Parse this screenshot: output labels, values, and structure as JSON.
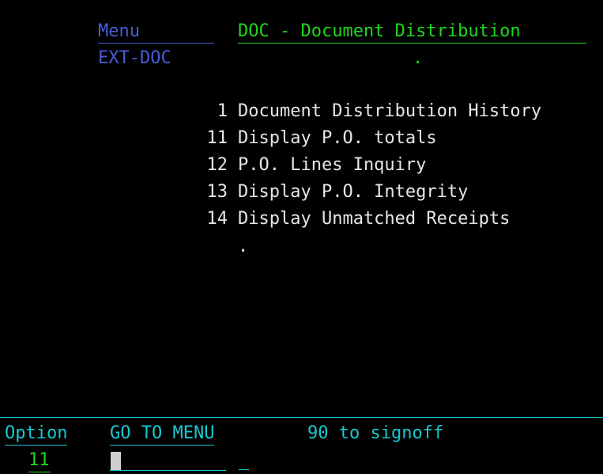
{
  "header": {
    "menu_label": "Menu",
    "menu_title": "DOC - Document Distribution",
    "menu_id": "EXT-DOC",
    "dot": "."
  },
  "options": [
    {
      "num": "1",
      "label": "Document Distribution History"
    },
    {
      "num": "11",
      "label": "Display P.O. totals"
    },
    {
      "num": "12",
      "label": "P.O. Lines Inquiry"
    },
    {
      "num": "13",
      "label": "Display P.O. Integrity"
    },
    {
      "num": "14",
      "label": "Display Unmatched Receipts"
    }
  ],
  "list_end_dot": ".",
  "footer": {
    "option_label": "Option",
    "goto_label": "GO TO MENU",
    "signoff_label": "90 to signoff",
    "option_value": "11",
    "command_value": ""
  },
  "colors": {
    "background": "#000000",
    "blue": "#4a5bd8",
    "green": "#1ed61e",
    "white": "#e6e6e6",
    "cyan": "#18c8d0"
  }
}
